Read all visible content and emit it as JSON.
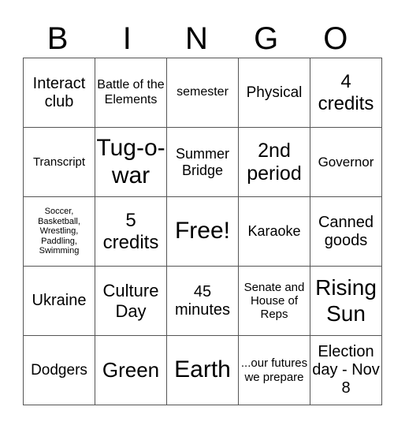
{
  "title_letters": [
    "B",
    "I",
    "N",
    "G",
    "O"
  ],
  "cells": [
    [
      "Interact club",
      "Battle of the Elements",
      "semester",
      "Physical",
      "4 credits"
    ],
    [
      "Transcript",
      "Tug-o-war",
      "Summer Bridge",
      "2nd period",
      "Governor"
    ],
    [
      "Soccer, Basketball, Wrestling, Paddling, Swimming",
      "5 credits",
      "Free!",
      "Karaoke",
      "Canned goods"
    ],
    [
      "Ukraine",
      "Culture Day",
      "45 minutes",
      "Senate and House of Reps",
      "Rising Sun"
    ],
    [
      "Dodgers",
      "Green",
      "Earth",
      "...our futures we prepare",
      "Election day - Nov 8"
    ]
  ]
}
